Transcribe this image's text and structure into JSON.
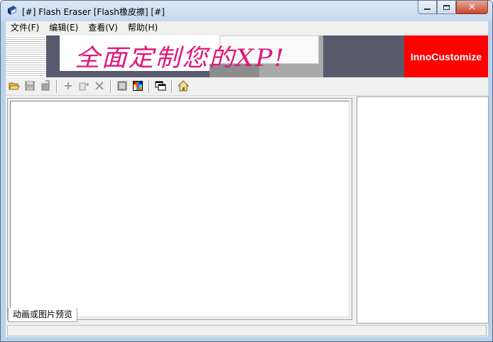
{
  "window": {
    "title": "[#] Flash Eraser [Flash橡皮擦] [#]"
  },
  "menu": [
    {
      "label": "文件(F)"
    },
    {
      "label": "编辑(E)"
    },
    {
      "label": "查看(V)"
    },
    {
      "label": "帮助(H)"
    }
  ],
  "banner": {
    "slogan": "全面定制您的XP!",
    "brand": "InnoCustomize",
    "brand_color": "#ff0000",
    "slogan_color": "#e0187a"
  },
  "toolbar": {
    "icons": [
      "open-folder-icon",
      "save-icon",
      "save-as-icon",
      "add-icon",
      "copy-icon",
      "delete-icon",
      "frame-icon",
      "palette-icon",
      "windows-icon",
      "home-icon"
    ]
  },
  "preview": {
    "tab_label": "动画或图片预览"
  }
}
